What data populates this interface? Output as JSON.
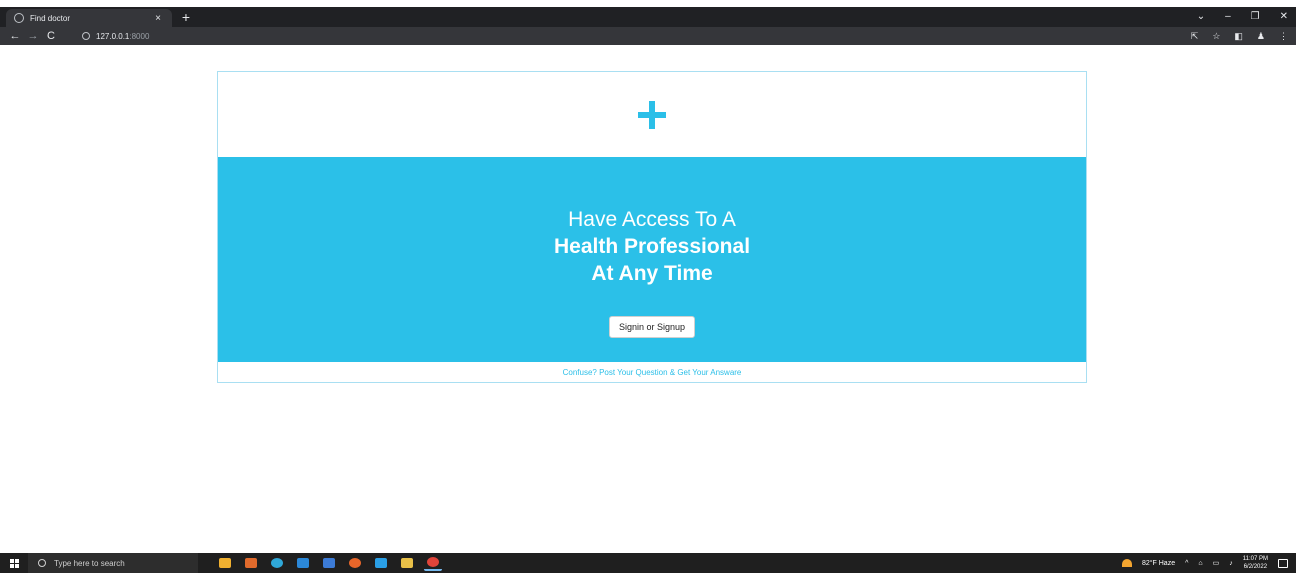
{
  "browser": {
    "tab_title": "Find doctor",
    "tab_close": "×",
    "new_tab": "+",
    "window_controls": {
      "tabsearch": "⌄",
      "minimize": "–",
      "restore": "❐",
      "close": "✕"
    },
    "nav": {
      "back": "←",
      "forward": "→",
      "reload": "C"
    },
    "url_host": "127.0.0.1",
    "url_port": ":8000",
    "toolbar_icons": {
      "share": "⇱",
      "bookmark": "☆",
      "sidepanel": "◧",
      "profile": "♟",
      "menu": "⋮"
    }
  },
  "page": {
    "logo_icon": "plus-icon",
    "hero": {
      "line1": "Have Access To A",
      "line2": "Health Professional",
      "line3": "At Any Time"
    },
    "cta_label": "Signin or Signup",
    "footer_link": "Confuse? Post Your Question & Get Your Answare",
    "accent_color": "#2bc0e8"
  },
  "taskbar": {
    "search_placeholder": "Type here to search",
    "apps": [
      "emoji-widget",
      "emoji-widget-2",
      "edge",
      "store",
      "vscode-insiders",
      "firefox",
      "vscode",
      "file-explorer",
      "chrome"
    ],
    "weather": "82°F  Haze",
    "tray_chevron": "^",
    "time": "11:07 PM",
    "date": "6/2/2022"
  }
}
